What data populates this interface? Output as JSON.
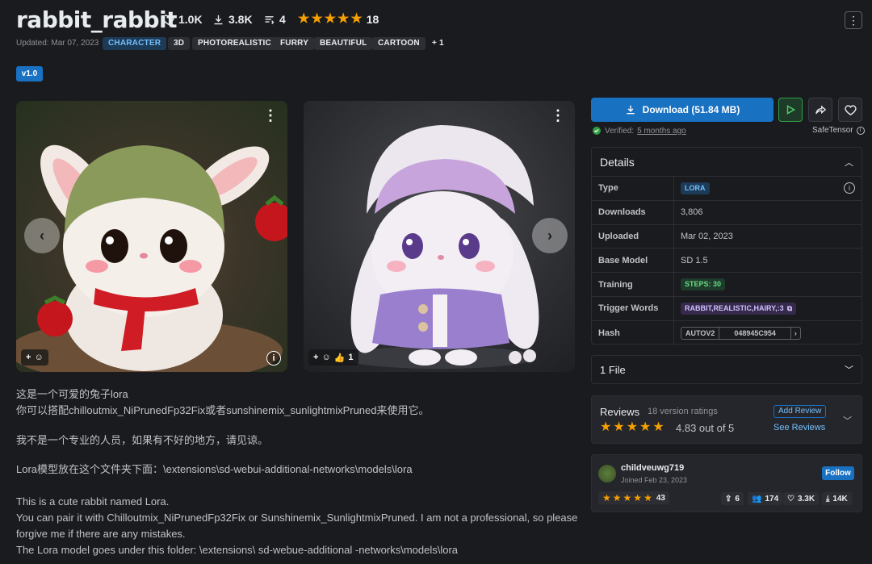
{
  "header": {
    "title": "rabbit_rabbit",
    "likes": "1.0K",
    "downloads": "3.8K",
    "comments": "4",
    "rating_count": "18",
    "updated": "Updated: Mar 07, 2023",
    "tags": [
      "CHARACTER",
      "3D",
      "PHOTOREALISTIC",
      "FURRY",
      "BEAUTIFUL",
      "CARTOON",
      "+ 1"
    ],
    "menu_icon": "vertical-dots-icon",
    "version": "v1.0"
  },
  "gallery": {
    "image1": {
      "subject": "white rabbit with green hat and red scarf"
    },
    "image2": {
      "subject": "white rabbit with purple hat and jacket",
      "reaction_count": "1"
    },
    "prev_icon": "chevron-left-icon",
    "next_icon": "chevron-right-icon"
  },
  "description": {
    "line1": "这是一个可爱的兔子lora",
    "line2": "你可以搭配chilloutmix_NiPrunedFp32Fix或者sunshinemix_sunlightmixPruned来使用它。",
    "line3": "我不是一个专业的人员，如果有不好的地方，请见谅。",
    "line4": "Lora模型放在这个文件夹下面：\\extensions\\sd-webui-additional-networks\\models\\lora",
    "line5": "This is a cute rabbit named Lora.",
    "line6": "You can pair it with Chilloutmix_NiPrunedFp32Fix or Sunshinemix_SunlightmixPruned. I am not a professional, so please",
    "line7": "forgive me if there are any mistakes.",
    "line8": "The Lora model goes under this folder: \\extensions\\ sd-webue-additional -networks\\models\\lora"
  },
  "sidebar": {
    "download_label": "Download (51.84 MB)",
    "verified_label": "Verified:",
    "verified_time": "5 months ago",
    "safetensor": "SafeTensor",
    "details_title": "Details",
    "details": {
      "type_key": "Type",
      "type_val": "LORA",
      "downloads_key": "Downloads",
      "downloads_val": "3,806",
      "uploaded_key": "Uploaded",
      "uploaded_val": "Mar 02, 2023",
      "base_key": "Base Model",
      "base_val": "SD 1.5",
      "training_key": "Training",
      "training_val": "STEPS: 30",
      "trigger_key": "Trigger Words",
      "trigger_val": "RABBIT,REALISTIC,HAIRY,:3",
      "hash_key": "Hash",
      "hash_type": "AUTOV2",
      "hash_val": "048945C954"
    },
    "files_title": "1 File",
    "reviews": {
      "title": "Reviews",
      "count": "18 version ratings",
      "score": "4.83 out of 5",
      "add_label": "Add Review",
      "see_label": "See Reviews"
    },
    "user": {
      "name": "childveuwg719",
      "joined": "Joined Feb 23, 2023",
      "follow_label": "Follow",
      "rating_count": "43",
      "uploads": "6",
      "followers": "174",
      "likes": "3.3K",
      "downloads": "14K"
    }
  },
  "colors": {
    "background": "#1a1b1e",
    "accent": "#1971c2",
    "star": "#f59f00",
    "green": "#2f9e44"
  }
}
